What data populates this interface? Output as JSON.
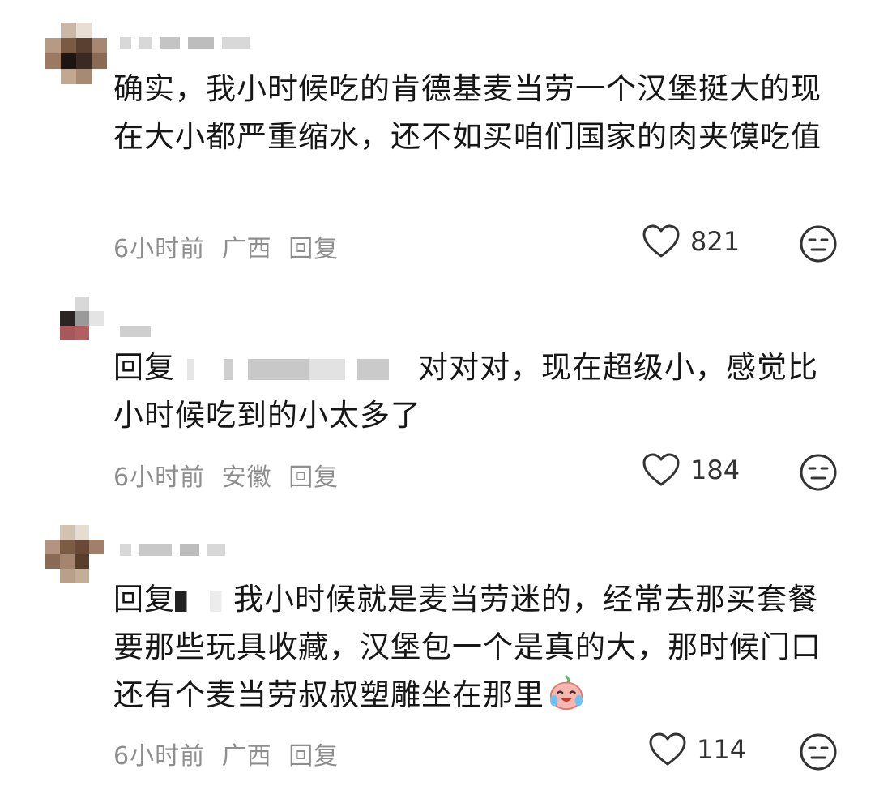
{
  "comments": [
    {
      "text": "确实，我小时候吃的肯德基麦当劳一个汉堡挺大的现在大小都严重缩水，还不如买咱们国家的肉夹馍吃值",
      "time": "6小时前",
      "location": "广西",
      "reply_label": "回复",
      "likes": "821"
    },
    {
      "reply_prefix": "回复",
      "text": "对对对，现在超级小，感觉比小时候吃到的小太多了",
      "time": "6小时前",
      "location": "安徽",
      "reply_label": "回复",
      "likes": "184"
    },
    {
      "reply_prefix": "回复",
      "text": "我小时候就是麦当劳迷的，经常去那买套餐要那些玩具收藏，汉堡包一个是真的大，那时候门口还有个麦当劳叔叔塑雕坐在那里",
      "time": "6小时前",
      "location": "广西",
      "reply_label": "回复",
      "likes": "114"
    }
  ],
  "icons": {
    "like": "heart-outline-icon",
    "reaction": "neutral-face-icon",
    "emoji": "crying-laugh-emoji"
  },
  "colors": {
    "meta_gray": "#8e8e8e",
    "text": "#161616",
    "icon": "#333333"
  }
}
